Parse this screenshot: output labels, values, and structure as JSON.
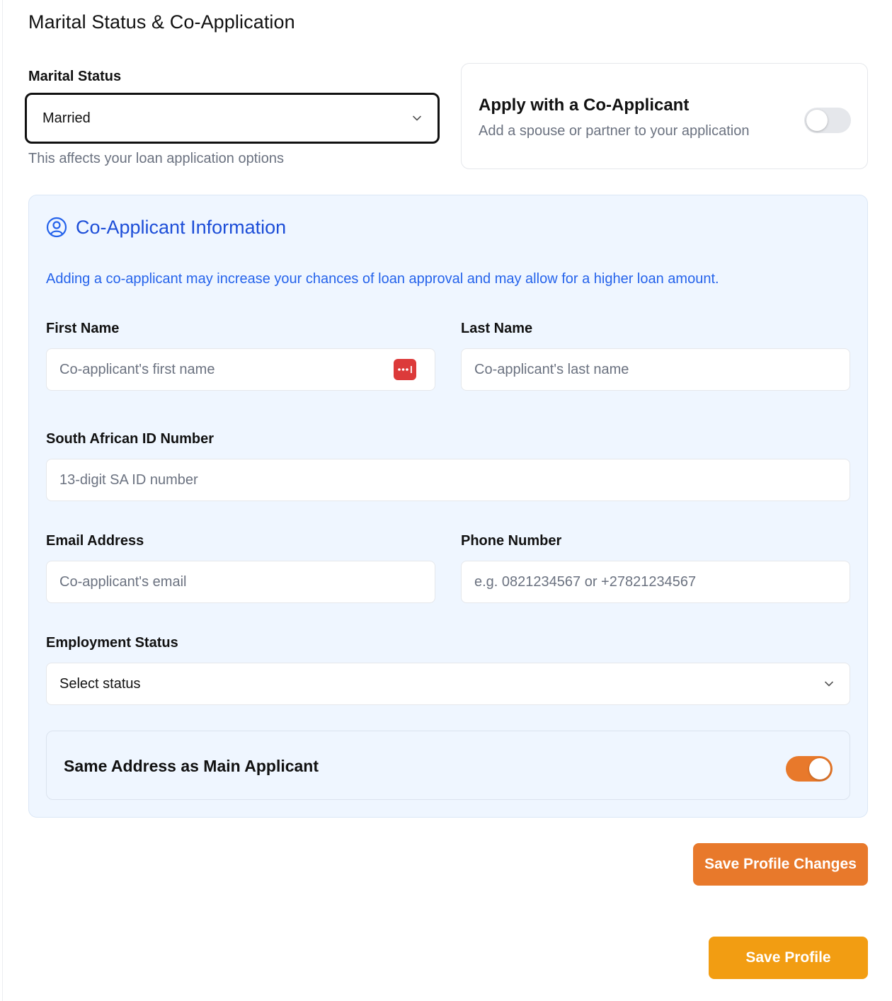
{
  "section": {
    "title": "Marital Status & Co-Application"
  },
  "marital": {
    "label": "Marital Status",
    "selected": "Married",
    "helper": "This affects your loan application options"
  },
  "co_app_card": {
    "title": "Apply with a Co-Applicant",
    "subtitle": "Add a spouse or partner to your application",
    "toggle_on": false
  },
  "co_applicant": {
    "title": "Co-Applicant Information",
    "note": "Adding a co-applicant may increase your chances of loan approval and may allow for a higher loan amount.",
    "first_name": {
      "label": "First Name",
      "placeholder": "Co-applicant's first name"
    },
    "last_name": {
      "label": "Last Name",
      "placeholder": "Co-applicant's last name"
    },
    "id_number": {
      "label": "South African ID Number",
      "placeholder": "13-digit SA ID number"
    },
    "email": {
      "label": "Email Address",
      "placeholder": "Co-applicant's email"
    },
    "phone": {
      "label": "Phone Number",
      "placeholder": "e.g. 0821234567 or +27821234567"
    },
    "employment": {
      "label": "Employment Status",
      "selected": "Select status"
    },
    "same_address": {
      "label": "Same Address as Main Applicant",
      "toggle_on": true
    }
  },
  "buttons": {
    "save_changes": "Save Profile Changes",
    "save_profile": "Save Profile"
  },
  "colors": {
    "accent_blue": "#1d4ed8",
    "toggle_on": "#e8792b",
    "save_changes_bg": "#e8792b",
    "save_profile_bg": "#f29d12",
    "panel_bg": "#eff6ff"
  }
}
